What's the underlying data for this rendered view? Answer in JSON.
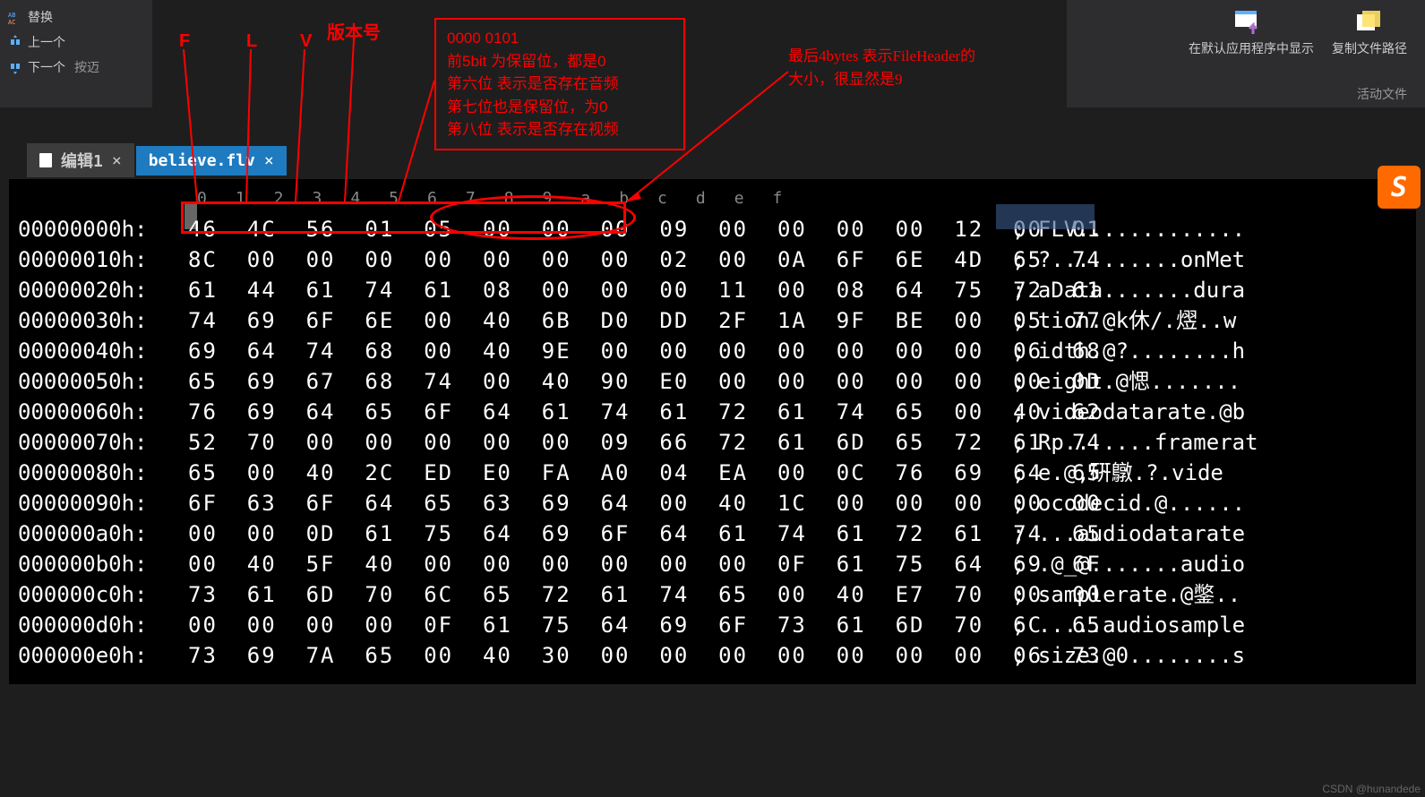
{
  "toolbar_left": {
    "replace": "替换",
    "prev": "上一个",
    "next": "下一个",
    "next_extra": "按迈"
  },
  "toolbar_right": {
    "open_default": "在默认应用程序中显示",
    "copy_path": "复制文件路径",
    "active_file": "活动文件"
  },
  "tabs": {
    "t1": "编辑1",
    "t2": "believe.flv"
  },
  "col_header": "0 1 2 3 4 5 6 7 8 9 a b c d e f",
  "rows": [
    {
      "off": "00000000h:",
      "hex": "46 4C 56 01 05 00 00 00 09 00 00 00 00 12 00 01",
      "asc": "; FLV............."
    },
    {
      "off": "00000010h:",
      "hex": "8C 00 00 00 00 00 00 00 02 00 0A 6F 6E 4D 65 74",
      "asc": "; ?..........onMet"
    },
    {
      "off": "00000020h:",
      "hex": "61 44 61 74 61 08 00 00 00 11 00 08 64 75 72 61",
      "asc": "; aData.......dura"
    },
    {
      "off": "00000030h:",
      "hex": "74 69 6F 6E 00 40 6B D0 DD 2F 1A 9F BE 00 05 77",
      "asc": "; tion.@k休/.熤..w"
    },
    {
      "off": "00000040h:",
      "hex": "69 64 74 68 00 40 9E 00 00 00 00 00 00 00 06 68",
      "asc": "; idth.@?........h"
    },
    {
      "off": "00000050h:",
      "hex": "65 69 67 68 74 00 40 90 E0 00 00 00 00 00 00 0D",
      "asc": "; eight.@愢......."
    },
    {
      "off": "00000060h:",
      "hex": "76 69 64 65 6F 64 61 74 61 72 61 74 65 00 40 62",
      "asc": "; videodatarate.@b"
    },
    {
      "off": "00000070h:",
      "hex": "52 70 00 00 00 00 00 09 66 72 61 6D 65 72 61 74",
      "asc": "; Rp.......framerat"
    },
    {
      "off": "00000080h:",
      "hex": "65 00 40 2C ED E0 FA A0 04 EA 00 0C 76 69 64 65",
      "asc": "; e.@,硏鷻.?.vide"
    },
    {
      "off": "00000090h:",
      "hex": "6F 63 6F 64 65 63 69 64 00 40 1C 00 00 00 00 00",
      "asc": "; ocodecid.@......"
    },
    {
      "off": "000000a0h:",
      "hex": "00 00 0D 61 75 64 69 6F 64 61 74 61 72 61 74 65",
      "asc": "; ...audiodatarate"
    },
    {
      "off": "000000b0h:",
      "hex": "00 40 5F 40 00 00 00 00 00 00 0F 61 75 64 69 6F",
      "asc": "; .@_@.......audio"
    },
    {
      "off": "000000c0h:",
      "hex": "73 61 6D 70 6C 65 72 61 74 65 00 40 E7 70 00 00",
      "asc": "; samplerate.@鐅.."
    },
    {
      "off": "000000d0h:",
      "hex": "00 00 00 00 0F 61 75 64 69 6F 73 61 6D 70 6C 65",
      "asc": "; .....audiosample"
    },
    {
      "off": "000000e0h:",
      "hex": "73 69 7A 65 00 40 30 00 00 00 00 00 00 00 06 73",
      "asc": "; size.@0........s"
    }
  ],
  "annotations": {
    "labels": {
      "F": "F",
      "L": "L",
      "V": "V",
      "version": "版本号"
    },
    "box1": [
      "0000 0101",
      "前5bit 为保留位，都是0",
      "第六位 表示是否存在音频",
      "第七位也是保留位，为0",
      "第八位 表示是否存在视频"
    ],
    "right": [
      "最后4bytes 表示FileHeader的",
      "大小，很显然是9"
    ]
  },
  "watermark": "CSDN @hunandede",
  "input_badge": "S"
}
